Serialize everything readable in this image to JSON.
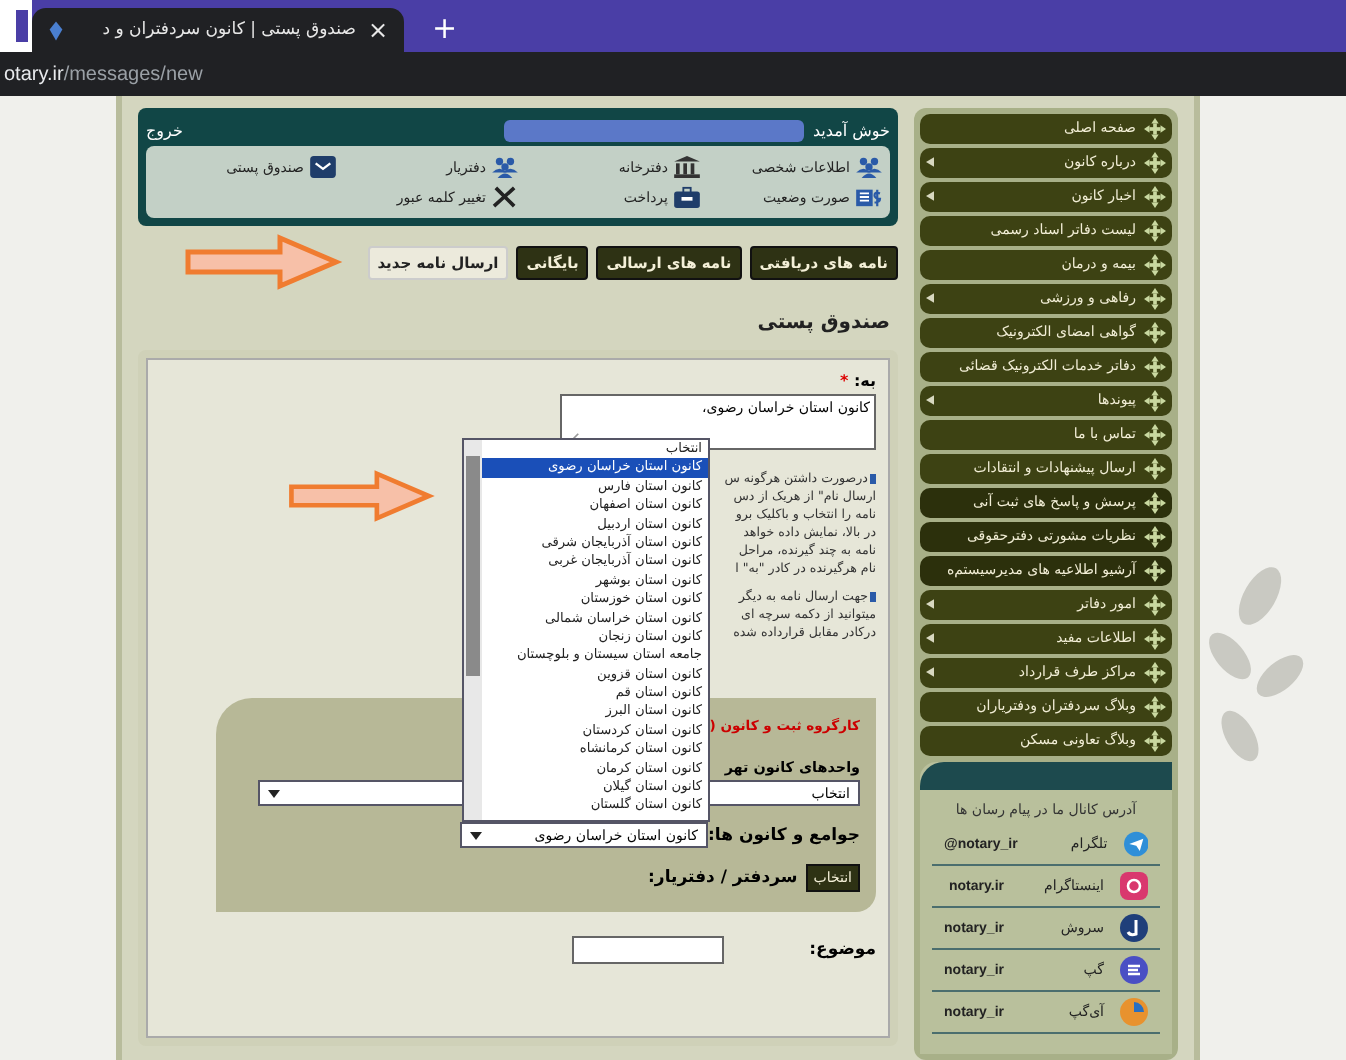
{
  "browser": {
    "tab_title": "صندوق پستی | کانون سردفتران و د",
    "close": "×",
    "new_tab": "+",
    "url_host": "otary.ir",
    "url_path": "/messages/new"
  },
  "header": {
    "greeting": "خوش آمدید",
    "logout": "خروج",
    "links": [
      {
        "label": "اطلاعات شخصی"
      },
      {
        "label": "دفترخانه"
      },
      {
        "label": "دفتریار"
      },
      {
        "label": "صندوق پستی"
      },
      {
        "label": "صورت وضعیت"
      },
      {
        "label": "پرداخت"
      },
      {
        "label": "تغییر کلمه عبور"
      }
    ]
  },
  "tabs": [
    {
      "label": "نامه های دریافتی",
      "selected": false
    },
    {
      "label": "نامه های ارسالی",
      "selected": false
    },
    {
      "label": "بایگانی",
      "selected": false
    },
    {
      "label": "ارسال نامه جدید",
      "selected": true
    }
  ],
  "page_title": "صندوق پستی",
  "form": {
    "to_label": "به:",
    "required_mark": "*",
    "to_value": "کانون استان خراسان رضوی،",
    "help": [
      {
        "lines": [
          "درصورت داشتن هرگونه س",
          "ارسال نام\" از هریک از دس",
          "نامه را انتخاب و باکلیک برو",
          "در بالا، نمایش داده خواهد",
          "نامه به چند گیرنده، مراحل",
          "نام هرگیرنده در کادر \"به\" ا"
        ]
      },
      {
        "lines": [
          "جهت ارسال نامه به دیگر",
          "میتوانید از دکمه سرچه ای",
          "درکادر مقابل قرارداده شده"
        ]
      }
    ],
    "group_title": "کارگروه ثبت و کانون (",
    "units_label": "واحدهای کانون تهر",
    "units_select": "انتخاب",
    "societies_label": "جوامع و کانون ها:",
    "societies_select": {
      "value": "کانون استان خراسان رضوی",
      "expanded": true,
      "options": [
        {
          "label": "انتخاب",
          "selected": false
        },
        {
          "label": "کانون استان خراسان رضوی",
          "selected": true
        },
        {
          "label": "کانون استان فارس",
          "selected": false
        },
        {
          "label": "کانون استان اصفهان",
          "selected": false
        },
        {
          "label": "کانون استان اردبیل",
          "selected": false
        },
        {
          "label": "کانون استان آذربایجان شرقی",
          "selected": false
        },
        {
          "label": "کانون استان آذربایجان غربی",
          "selected": false
        },
        {
          "label": "کانون استان بوشهر",
          "selected": false
        },
        {
          "label": "کانون استان خوزستان",
          "selected": false
        },
        {
          "label": "کانون استان خراسان شمالی",
          "selected": false
        },
        {
          "label": "کانون استان زنجان",
          "selected": false
        },
        {
          "label": "جامعه استان سیستان و بلوچستان",
          "selected": false
        },
        {
          "label": "کانون استان قزوین",
          "selected": false
        },
        {
          "label": "کانون استان قم",
          "selected": false
        },
        {
          "label": "کانون استان البرز",
          "selected": false
        },
        {
          "label": "کانون استان کردستان",
          "selected": false
        },
        {
          "label": "کانون استان کرمانشاه",
          "selected": false
        },
        {
          "label": "کانون استان کرمان",
          "selected": false
        },
        {
          "label": "کانون استان گیلان",
          "selected": false
        },
        {
          "label": "کانون استان گلستان",
          "selected": false
        }
      ]
    },
    "notary_label": "سردفتر / دفتریار:",
    "notary_button": "انتخاب",
    "subject_label": "موضوع:"
  },
  "sidebar": {
    "items": [
      {
        "label": "صفحه اصلی",
        "submenu": false
      },
      {
        "label": "درباره کانون",
        "submenu": true
      },
      {
        "label": "اخبار کانون",
        "submenu": true
      },
      {
        "label": "لیست دفاتر اسناد رسمی",
        "submenu": false
      },
      {
        "label": "بیمه و درمان",
        "submenu": false
      },
      {
        "label": "رفاهی و ورزشی",
        "submenu": true
      },
      {
        "label": "گواهی امضای الکترونیک",
        "submenu": false
      },
      {
        "label": "دفاتر خدمات الکترونیک قضائی",
        "submenu": false
      },
      {
        "label": "پیوندها",
        "submenu": true
      },
      {
        "label": "تماس با ما",
        "submenu": false
      },
      {
        "label": "ارسال پیشنهادات و انتقادات",
        "submenu": false
      },
      {
        "label": "پرسش و پاسخ های ثبت آنی",
        "submenu": false
      },
      {
        "label": "نظریات مشورتی دفترحقوقی",
        "submenu": false
      },
      {
        "label": "آرشیو اطلاعیه های مدیرسیستم‌ه",
        "submenu": false
      },
      {
        "label": "امور دفاتر",
        "submenu": true
      },
      {
        "label": "اطلاعات مفید",
        "submenu": true
      },
      {
        "label": "مراکز طرف قرارداد",
        "submenu": true
      },
      {
        "label": "وبلاگ سردفتران ودفتریاران",
        "submenu": false
      },
      {
        "label": "وبلاگ تعاونی مسکن",
        "submenu": false
      }
    ],
    "channels": {
      "title": "آدرس کانال ما در پیام رسان ها",
      "items": [
        {
          "name": "تلگرام",
          "handle": "@notary_ir"
        },
        {
          "name": "اینستاگرام",
          "handle": "notary.ir"
        },
        {
          "name": "سروش",
          "handle": "notary_ir"
        },
        {
          "name": "گپ",
          "handle": "notary_ir"
        },
        {
          "name": "آی‌گپ",
          "handle": "notary_ir"
        }
      ]
    }
  }
}
